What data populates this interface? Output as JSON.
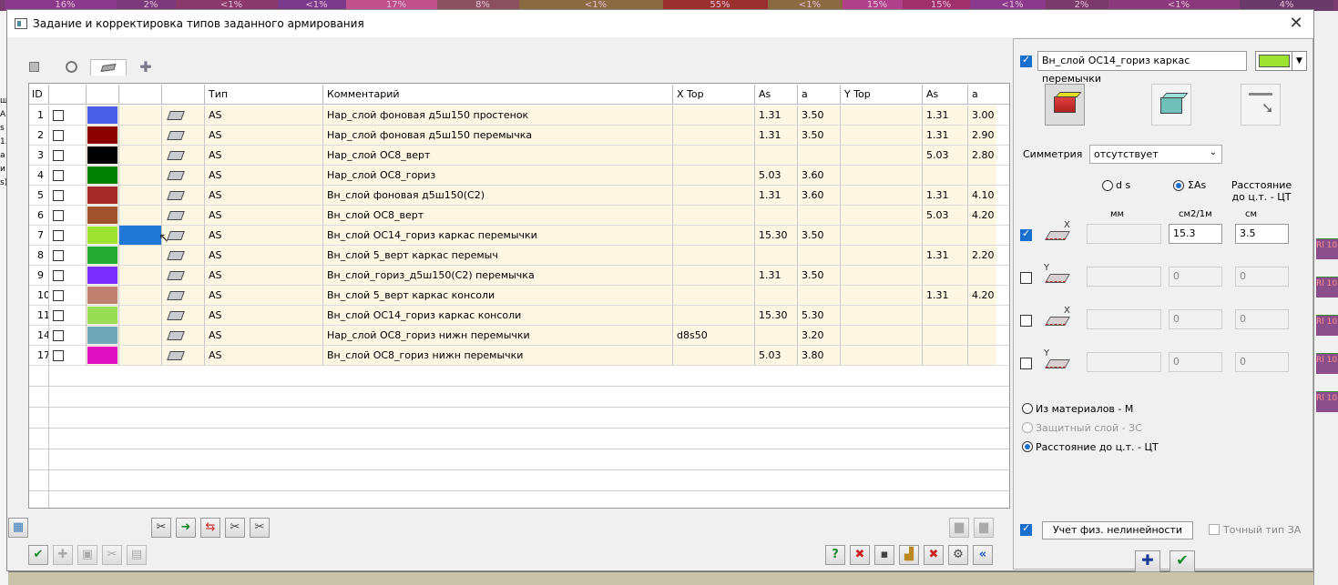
{
  "background": {
    "top_percents": [
      "16%",
      "2%",
      "<1%",
      "<1%",
      "17%",
      "8%",
      "<1%",
      "55%",
      "<1%",
      "15%",
      "15%",
      "<1%",
      "2%",
      "<1%",
      "4%"
    ],
    "left_text": [
      "ш",
      "А!",
      "s",
      "1.",
      "а",
      "и",
      "s)"
    ],
    "right_cells": [
      "Rl 10",
      "Rl 10",
      "Rl 10",
      "Rl 10",
      "Rl 10"
    ]
  },
  "dialog": {
    "title": "Задание и корректировка типов заданного армирования",
    "close_icon": "close-icon"
  },
  "tabs": [
    {
      "icon": "square-icon"
    },
    {
      "icon": "circle-icon"
    },
    {
      "icon": "plate-icon"
    },
    {
      "icon": "cross-section-icon"
    }
  ],
  "table": {
    "headers": [
      "ID",
      "",
      "",
      "",
      "",
      "Тип",
      "Комментарий",
      "X Top",
      "As",
      "a",
      "Y Top",
      "As",
      "a"
    ],
    "rows": [
      {
        "id": "1",
        "color": "#4a5fe8",
        "type": "AS",
        "comment": "Нар_слой фоновая д5ш150 простенок",
        "xtop": "",
        "xas": "1.31",
        "xa": "3.50",
        "ytop": "",
        "yas": "1.31",
        "ya": "3.00"
      },
      {
        "id": "2",
        "color": "#8b0000",
        "type": "AS",
        "comment": "Нар_слой фоновая д5ш150 перемычка",
        "xtop": "",
        "xas": "1.31",
        "xa": "3.50",
        "ytop": "",
        "yas": "1.31",
        "ya": "2.90"
      },
      {
        "id": "3",
        "color": "#000000",
        "type": "AS",
        "comment": "Нар_слой ОС8_верт",
        "xtop": "",
        "xas": "",
        "xa": "",
        "ytop": "",
        "yas": "5.03",
        "ya": "2.80"
      },
      {
        "id": "4",
        "color": "#008000",
        "type": "AS",
        "comment": "Нар_слой ОС8_гориз",
        "xtop": "",
        "xas": "5.03",
        "xa": "3.60",
        "ytop": "",
        "yas": "",
        "ya": ""
      },
      {
        "id": "5",
        "color": "#a52a2a",
        "type": "AS",
        "comment": "Вн_слой фоновая д5ш150(С2)",
        "xtop": "",
        "xas": "1.31",
        "xa": "3.60",
        "ytop": "",
        "yas": "1.31",
        "ya": "4.10"
      },
      {
        "id": "6",
        "color": "#a0522d",
        "type": "AS",
        "comment": "Вн_слой ОС8_верт",
        "xtop": "",
        "xas": "",
        "xa": "",
        "ytop": "",
        "yas": "5.03",
        "ya": "4.20"
      },
      {
        "id": "7",
        "color": "#9de32f",
        "type": "AS",
        "comment": "Вн_слой ОС14_гориз каркас перемычки",
        "xtop": "",
        "xas": "15.30",
        "xa": "3.50",
        "ytop": "",
        "yas": "",
        "ya": ""
      },
      {
        "id": "8",
        "color": "#22aa33",
        "type": "AS",
        "comment": "Вн_слой 5_верт каркас перемыч",
        "xtop": "",
        "xas": "",
        "xa": "",
        "ytop": "",
        "yas": "1.31",
        "ya": "2.20"
      },
      {
        "id": "9",
        "color": "#7b2fff",
        "type": "AS",
        "comment": "Вн_слой_гориз_д5ш150(С2) перемычка",
        "xtop": "",
        "xas": "1.31",
        "xa": "3.50",
        "ytop": "",
        "yas": "",
        "ya": ""
      },
      {
        "id": "10",
        "color": "#c08070",
        "type": "AS",
        "comment": "Вн_слой 5_верт каркас консоли",
        "xtop": "",
        "xas": "",
        "xa": "",
        "ytop": "",
        "yas": "1.31",
        "ya": "4.20"
      },
      {
        "id": "11",
        "color": "#99dd55",
        "type": "AS",
        "comment": "Вн_слой ОС14_гориз каркас консоли",
        "xtop": "",
        "xas": "15.30",
        "xa": "5.30",
        "ytop": "",
        "yas": "",
        "ya": ""
      },
      {
        "id": "14",
        "color": "#6fa8b8",
        "type": "AS",
        "comment": "Нар_слой ОС8_гориз нижн перемычки",
        "xtop": "d8s50",
        "xas": "",
        "xa": "3.20",
        "ytop": "",
        "yas": "",
        "ya": ""
      },
      {
        "id": "17",
        "color": "#e010c0",
        "type": "AS",
        "comment": "Вн_слой ОС8_гориз нижн перемычки",
        "xtop": "",
        "xas": "5.03",
        "xa": "3.80",
        "ytop": "",
        "yas": "",
        "ya": ""
      }
    ],
    "selected_row_fill": "#1f78d6"
  },
  "right_panel": {
    "layer_name": "Вн_слой ОС14_гориз каркас перемычки",
    "layer_color": "#9de32f",
    "symmetry_label": "Симметрия",
    "symmetry_value": "отсутствует",
    "radio_ds": "d s",
    "radio_sum": "ΣAs",
    "dist_header": "Расстояние до ц.т. - ЦТ",
    "unit_mm": "мм",
    "unit_cm2": "см2/1м",
    "unit_cm": "см",
    "rows": [
      {
        "checked": true,
        "d": "",
        "as": "15.3",
        "dist": "3.5"
      },
      {
        "checked": false,
        "d": "",
        "as": "0",
        "dist": "0"
      },
      {
        "checked": false,
        "d": "",
        "as": "0",
        "dist": "0"
      },
      {
        "checked": false,
        "d": "",
        "as": "0",
        "dist": "0"
      }
    ],
    "opt_materials": "Из материалов - М",
    "opt_cover": "Защитный слой - ЗС",
    "opt_distance": "Расстояние до ц.т. - ЦТ",
    "nonlinear_label": "Учет физ. нелинейности",
    "exact_type_label": "Точный тип ЗА"
  },
  "colors": {
    "accent": "#1a6fce",
    "row_bg": "#fdf6e3"
  }
}
